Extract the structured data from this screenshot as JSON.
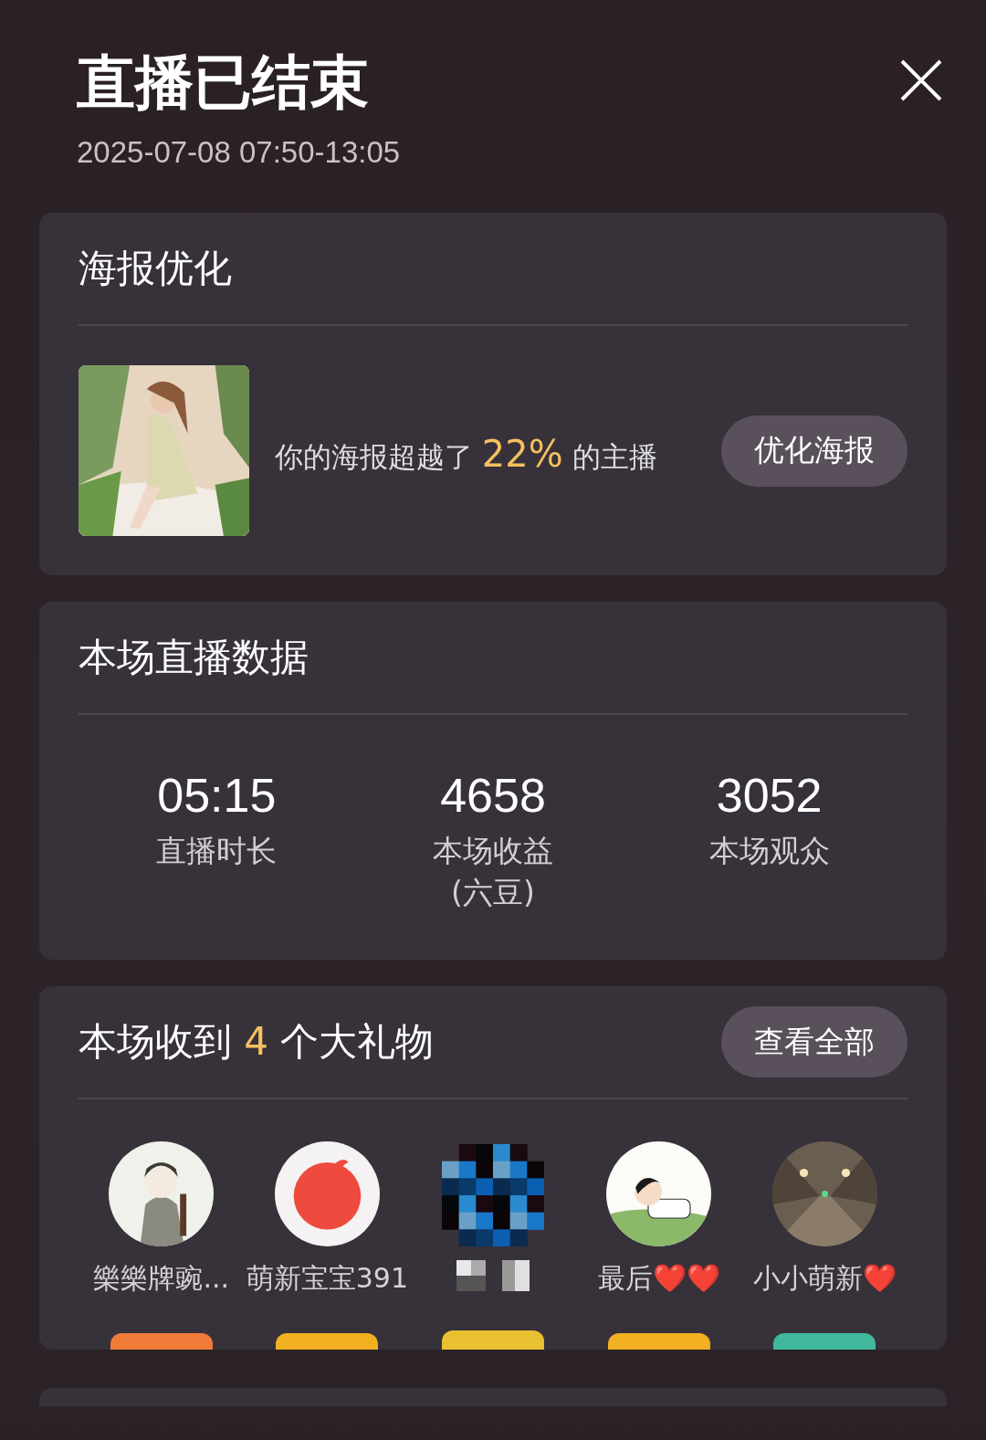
{
  "header": {
    "title": "直播已结束",
    "time_range": "2025-07-08 07:50-13:05"
  },
  "poster": {
    "title": "海报优化",
    "text_before": "你的海报超越了 ",
    "highlight": "22%",
    "text_after": " 的主播",
    "button": "优化海报"
  },
  "stats": {
    "title": "本场直播数据",
    "items": [
      {
        "value": "05:15",
        "label": "直播时长"
      },
      {
        "value": "4658",
        "label": "本场收益\n(六豆)"
      },
      {
        "value": "3052",
        "label": "本场观众"
      }
    ]
  },
  "gifts": {
    "title_before": "本场收到 ",
    "count": "4",
    "title_after": " 个大礼物",
    "button": "查看全部",
    "senders": [
      {
        "kind": "picture",
        "name": "樂樂牌豌...",
        "color": "#f07a38"
      },
      {
        "kind": "picture",
        "name": "萌新宝宝391",
        "color": "#f0b020"
      },
      {
        "kind": "pixelated",
        "color": "#e8c030"
      },
      {
        "kind": "picture",
        "name": "最后❤️❤️",
        "color": "#f0b020"
      },
      {
        "kind": "picture",
        "name": "小小萌新❤️",
        "color": "#3fb89c"
      }
    ]
  }
}
